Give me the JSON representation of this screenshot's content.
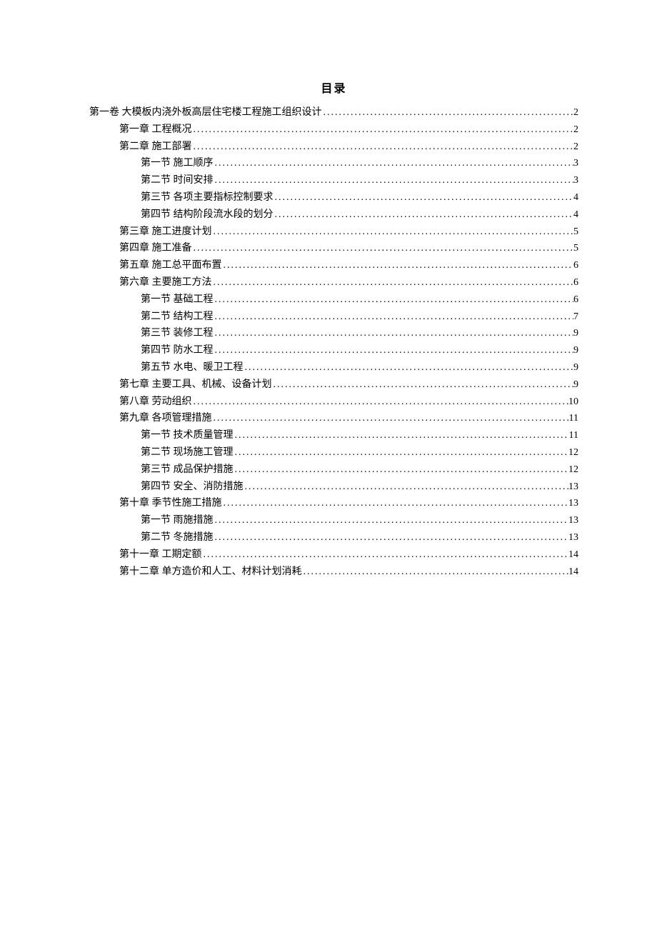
{
  "title": "目录",
  "toc": [
    {
      "level": 0,
      "label": "第一卷 大模板内浇外板高层住宅楼工程施工组织设计",
      "page": "2"
    },
    {
      "level": 1,
      "label": "第一章 工程概况",
      "page": "2"
    },
    {
      "level": 1,
      "label": "第二章 施工部署",
      "page": "2"
    },
    {
      "level": 2,
      "label": "第一节 施工顺序",
      "page": "3"
    },
    {
      "level": 2,
      "label": "第二节 时间安排",
      "page": "3"
    },
    {
      "level": 2,
      "label": "第三节 各项主要指标控制要求",
      "page": "4"
    },
    {
      "level": 2,
      "label": "第四节 结构阶段流水段的划分",
      "page": "4"
    },
    {
      "level": 1,
      "label": "第三章 施工进度计划",
      "page": "5"
    },
    {
      "level": 1,
      "label": "第四章 施工准备",
      "page": "5"
    },
    {
      "level": 1,
      "label": "第五章 施工总平面布置",
      "page": "6"
    },
    {
      "level": 1,
      "label": "第六章 主要施工方法",
      "page": "6"
    },
    {
      "level": 2,
      "label": "第一节 基础工程",
      "page": "6"
    },
    {
      "level": 2,
      "label": "第二节 结构工程",
      "page": "7"
    },
    {
      "level": 2,
      "label": "第三节 装修工程",
      "page": "9"
    },
    {
      "level": 2,
      "label": "第四节 防水工程",
      "page": "9"
    },
    {
      "level": 2,
      "label": "第五节 水电、暖卫工程",
      "page": "9"
    },
    {
      "level": 1,
      "label": "第七章 主要工具、机械、设备计划",
      "page": "9"
    },
    {
      "level": 1,
      "label": "第八章 劳动组织",
      "page": "10"
    },
    {
      "level": 1,
      "label": "第九章 各项管理措施",
      "page": "11"
    },
    {
      "level": 2,
      "label": "第一节 技术质量管理",
      "page": "11"
    },
    {
      "level": 2,
      "label": "第二节 现场施工管理",
      "page": "12"
    },
    {
      "level": 2,
      "label": "第三节 成品保护措施",
      "page": "12"
    },
    {
      "level": 2,
      "label": "第四节 安全、消防措施",
      "page": "13"
    },
    {
      "level": 1,
      "label": "第十章 季节性施工措施",
      "page": "13"
    },
    {
      "level": 2,
      "label": "第一节 雨施措施",
      "page": "13"
    },
    {
      "level": 2,
      "label": "第二节 冬施措施",
      "page": "13"
    },
    {
      "level": 1,
      "label": "第十一章 工期定额",
      "page": "14"
    },
    {
      "level": 1,
      "label": "第十二章 单方造价和人工、材料计划消耗",
      "page": "14"
    }
  ]
}
